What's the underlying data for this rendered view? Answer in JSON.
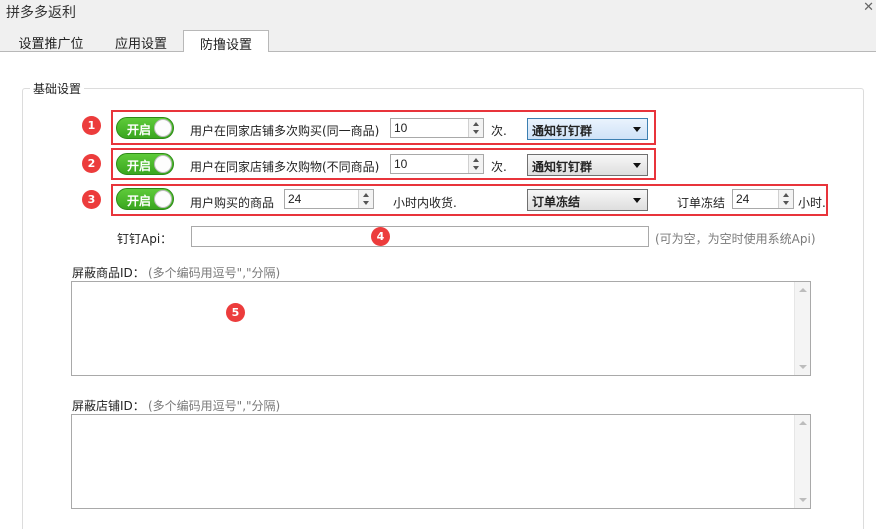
{
  "window": {
    "title": "拼多多返利",
    "close_glyph": "✕"
  },
  "tabs": [
    {
      "label": "设置推广位"
    },
    {
      "label": "应用设置"
    },
    {
      "label": "防撸设置",
      "active": true
    }
  ],
  "group": {
    "title": "基础设置"
  },
  "rows": [
    {
      "badge": "1",
      "toggle": "开启",
      "label": "用户在同家店铺多次购买(同一商品)",
      "count": "10",
      "unit": "次.",
      "action": "通知钉钉群"
    },
    {
      "badge": "2",
      "toggle": "开启",
      "label": "用户在同家店铺多次购物(不同商品)",
      "count": "10",
      "unit": "次.",
      "action": "通知钉钉群"
    },
    {
      "badge": "3",
      "toggle": "开启",
      "label": "用户购买的商品",
      "hours": "24",
      "unit": "小时内收货.",
      "action": "订单冻结",
      "freeze_label": "订单冻结",
      "freeze_hours": "24",
      "freeze_unit": "小时."
    }
  ],
  "dingtalk": {
    "label": "钉钉Api：",
    "value": "",
    "hint": "(可为空，为空时使用系统Api)",
    "badge": "4"
  },
  "block_goods": {
    "label": "屏蔽商品ID：",
    "hint": "(多个编码用逗号\",\"分隔)",
    "value": "",
    "badge": "5"
  },
  "block_shops": {
    "label": "屏蔽店铺ID：",
    "hint": "(多个编码用逗号\",\"分隔)",
    "value": ""
  },
  "colors": {
    "highlight": "#e8343b",
    "toggle_on": "#3aa61f",
    "badge": "#ec3c3c"
  },
  "icons": [
    "close-icon",
    "spin-up-icon",
    "spin-down-icon",
    "dropdown-caret-icon",
    "scroll-up-icon",
    "scroll-down-icon"
  ]
}
